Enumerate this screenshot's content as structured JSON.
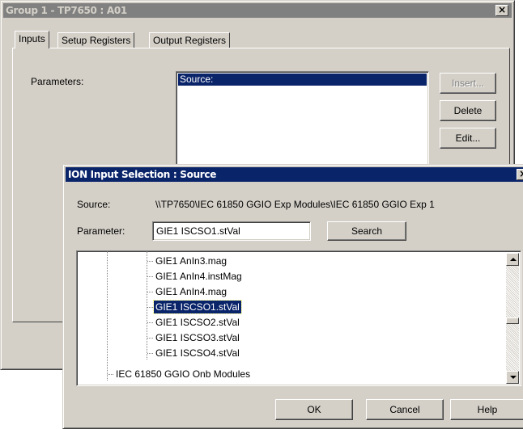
{
  "back_window": {
    "title": "Group 1 - TP7650 : A01",
    "close_glyph": "×",
    "tabs": [
      "Inputs",
      "Setup Registers",
      "Output Registers"
    ],
    "parameters_label": "Parameters:",
    "list_items": [
      "Source:"
    ],
    "buttons": {
      "insert": "Insert...",
      "delete": "Delete",
      "edit": "Edit..."
    }
  },
  "dialog": {
    "title": "ION Input Selection : Source",
    "close_glyph": "×",
    "source_label": "Source:",
    "source_value": "\\\\TP7650\\IEC 61850 GGIO Exp Modules\\IEC 61850 GGIO Exp 1",
    "parameter_label": "Parameter:",
    "parameter_value": "GIE1 ISCSO1.stVal",
    "search_button": "Search",
    "tree_items": [
      "GIE1 AnIn3.mag",
      "GIE1 AnIn4.instMag",
      "GIE1 AnIn4.mag",
      "GIE1 ISCSO1.stVal",
      "GIE1 ISCSO2.stVal",
      "GIE1 ISCSO3.stVal",
      "GIE1 ISCSO4.stVal"
    ],
    "tree_parent": "IEC 61850 GGIO Onb Modules",
    "selected_item": "GIE1 ISCSO1.stVal",
    "buttons": {
      "ok": "OK",
      "cancel": "Cancel",
      "help": "Help"
    }
  },
  "colors": {
    "face": "#d4d0c8",
    "selection": "#0a246a",
    "inactive_title": "#808080"
  }
}
